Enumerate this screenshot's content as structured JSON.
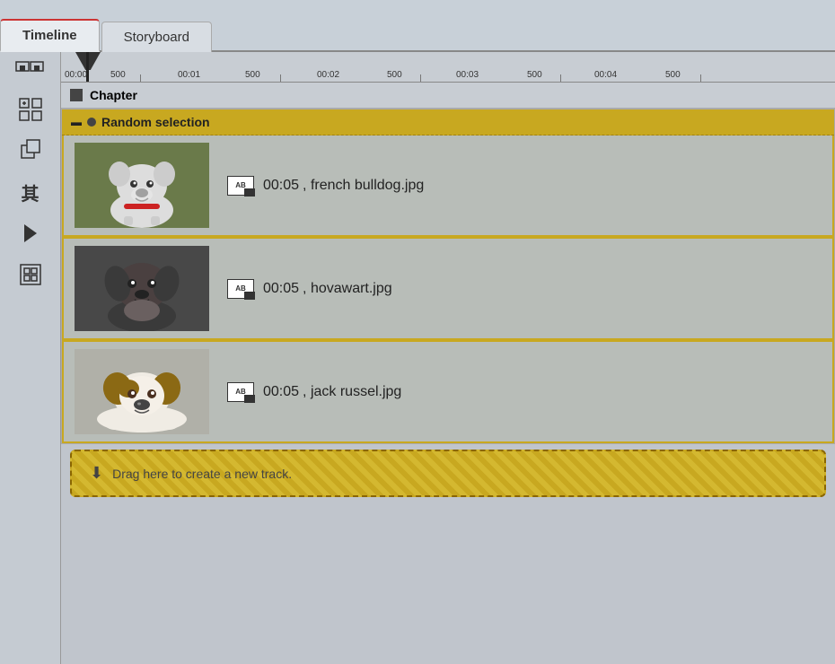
{
  "tabs": [
    {
      "id": "timeline",
      "label": "Timeline",
      "active": true
    },
    {
      "id": "storyboard",
      "label": "Storyboard",
      "active": false
    }
  ],
  "toolbar": {
    "icons": [
      {
        "id": "grid-icon",
        "symbol": "⊞",
        "label": "Grid"
      },
      {
        "id": "add-track-icon",
        "symbol": "⊕",
        "label": "Add Track"
      },
      {
        "id": "copy-icon",
        "symbol": "⧉",
        "label": "Copy"
      },
      {
        "id": "translate-icon",
        "symbol": "其",
        "label": "Translate"
      },
      {
        "id": "play-icon",
        "symbol": "▶",
        "label": "Play"
      },
      {
        "id": "layout-icon",
        "symbol": "⊡",
        "label": "Layout"
      }
    ]
  },
  "ruler": {
    "marks": [
      {
        "time": "00:00",
        "pos": 0
      },
      {
        "time": "00:01",
        "pos": 165
      },
      {
        "time": "00:02",
        "pos": 330
      },
      {
        "time": "00:03",
        "pos": 495
      },
      {
        "time": "00:04",
        "pos": 660
      }
    ],
    "mid_marks": [
      {
        "label": "500",
        "pos": 83
      },
      {
        "label": "500",
        "pos": 248
      },
      {
        "label": "500",
        "pos": 413
      },
      {
        "label": "500",
        "pos": 578
      },
      {
        "label": "500",
        "pos": 743
      }
    ]
  },
  "chapter": {
    "label": "Chapter"
  },
  "track_group": {
    "label": "Random selection"
  },
  "tracks": [
    {
      "id": "track-1",
      "duration": "00:05",
      "filename": "french bulldog.jpg",
      "dog_type": "dog1"
    },
    {
      "id": "track-2",
      "duration": "00:05",
      "filename": "hovawart.jpg",
      "dog_type": "dog2"
    },
    {
      "id": "track-3",
      "duration": "00:05",
      "filename": "jack russel.jpg",
      "dog_type": "dog3"
    }
  ],
  "drop_zone": {
    "label": "Drag here to create a new track."
  },
  "colors": {
    "accent_gold": "#c8a820",
    "tab_active_border": "#cc3333",
    "bg_main": "#c0c5cc"
  }
}
